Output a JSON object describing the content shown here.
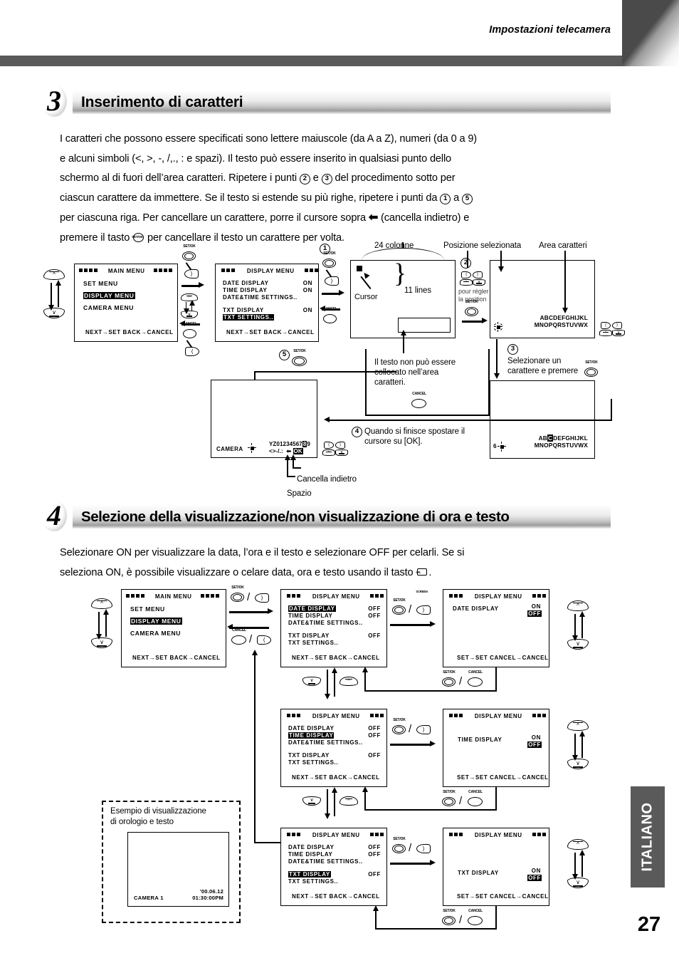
{
  "header": {
    "title": "Impostazioni telecamera"
  },
  "footer": {
    "language_tab": "ITALIANO",
    "page_number": "27"
  },
  "section3": {
    "number": "3",
    "title": "Inserimento di caratteri",
    "paragraph_lines": [
      "I caratteri che possono essere specificati sono lettere maiuscole (da A a Z), numeri (da 0 a 9)",
      "e alcuni simboli (<, >, -, /,., : e spazi). Il testo può essere inserito in qualsiasi punto dello",
      "schermo al di fuori dell’area caratteri. Ripetere i punti ② e ③ del procedimento sotto per",
      "ciascun carattere da immettere. Se il testo si estende su più righe, ripetere i punti da ① a ⑤",
      "per ciascuna riga. Per cancellare un carattere, porre il cursore sopra ← (cancella indietro) e",
      "premere il tasto ⊙ per cancellare il testo un carattere per volta."
    ]
  },
  "section4": {
    "number": "4",
    "title": "Selezione della visualizzazione/non visualizzazione di ora e testo",
    "paragraph_lines": [
      "Selezionare ON per visualizzare la data, l’ora e il testo e selezionare OFF per celarli. Se si",
      "seleziona ON, è possibile visualizzare o celare data, ora e testo usando il tasto ▭ ."
    ]
  },
  "buttons": {
    "setok": "SET/OK",
    "cancel": "CANCEL",
    "onscreen": "ON SCREEN"
  },
  "diagram1": {
    "screen_main_menu": {
      "title": "MAIN  MENU",
      "items": [
        "SET MENU",
        "DISPLAY MENU",
        "CAMERA MENU"
      ],
      "selected": "DISPLAY MENU",
      "footer": "NEXT→SET  BACK→CANCEL"
    },
    "screen_display_menu": {
      "title": "DISPLAY MENU",
      "rows": [
        {
          "label": "DATE DISPLAY",
          "value": "ON"
        },
        {
          "label": "TIME DISPLAY",
          "value": "ON"
        },
        {
          "label": "DATE&TIME SETTINGS..",
          "value": ""
        },
        {
          "label": "TXT DISPLAY",
          "value": "ON"
        },
        {
          "label": "TXT SETTINGS..",
          "value": ""
        }
      ],
      "selected": "TXT SETTINGS..",
      "footer": "NEXT→SET  BACK→CANCEL"
    },
    "labels": {
      "columns": "24 colonne",
      "selected_position": "Posizione selezionata",
      "char_area": "Area caratteri",
      "cursor": "Cursor",
      "lines": "11 lines",
      "no_text_note": "Il testo non può essere collocato nell’area caratteri.",
      "pour_regler": "pour régler la position",
      "step3_note": "Selezionare un carattere e premere",
      "step4_note": "Quando si finisce spostare il cursore su [OK].",
      "cancella_indietro": "Cancella indietro",
      "spazio": "Spazio"
    },
    "steps": {
      "s1": "1",
      "s2": "2",
      "s3": "3",
      "s4": "4",
      "s5": "5"
    },
    "char_palette": {
      "line1": "ABCDEFGHIJKL",
      "line2": "MNOPQRSTUVWX"
    },
    "char_palette_selected": {
      "line1": "ABCDEFGHIJKL",
      "line2": "MNOPQRSTUVWX",
      "highlight": "C"
    },
    "text_entry_screen": {
      "camera_label": "CAMERA",
      "entered_char": "",
      "palette_line1": "YZ0123456789",
      "palette_line2": "<>-/.:  ←",
      "ok_key": "OK",
      "second_char": "6"
    }
  },
  "diagram2": {
    "screen_main_menu": {
      "title": "MAIN  MENU",
      "items": [
        "SET MENU",
        "DISPLAY MENU",
        "CAMERA MENU"
      ],
      "selected": "DISPLAY MENU",
      "footer": "NEXT→SET  BACK→CANCEL"
    },
    "rows": [
      {
        "list_screen": {
          "title": "DISPLAY MENU",
          "rows": [
            {
              "label": "DATE DISPLAY",
              "value": "OFF"
            },
            {
              "label": "TIME DISPLAY",
              "value": "OFF"
            },
            {
              "label": "DATE&TIME SETTINGS..",
              "value": ""
            },
            {
              "label": "TXT DISPLAY",
              "value": "OFF"
            },
            {
              "label": "TXT SETTINGS..",
              "value": ""
            }
          ],
          "selected": "DATE DISPLAY",
          "footer": "NEXT→SET  BACK→CANCEL"
        },
        "detail_screen": {
          "title": "DISPLAY MENU",
          "item_label": "DATE DISPLAY",
          "option_on": "ON",
          "option_off": "OFF",
          "selected_option": "OFF",
          "footer": "SET→SET CANCEL→CANCEL"
        }
      },
      {
        "list_screen": {
          "title": "DISPLAY MENU",
          "rows": [
            {
              "label": "DATE DISPLAY",
              "value": "OFF"
            },
            {
              "label": "TIME DISPLAY",
              "value": "OFF"
            },
            {
              "label": "DATE&TIME SETTINGS..",
              "value": ""
            },
            {
              "label": "TXT DISPLAY",
              "value": "OFF"
            },
            {
              "label": "TXT SETTINGS..",
              "value": ""
            }
          ],
          "selected": "TIME DISPLAY",
          "footer": "NEXT→SET  BACK→CANCEL"
        },
        "detail_screen": {
          "title": "DISPLAY MENU",
          "item_label": "TIME DISPLAY",
          "option_on": "ON",
          "option_off": "OFF",
          "selected_option": "OFF",
          "footer": "SET→SET CANCEL→CANCEL"
        }
      },
      {
        "list_screen": {
          "title": "DISPLAY MENU",
          "rows": [
            {
              "label": "DATE DISPLAY",
              "value": "OFF"
            },
            {
              "label": "TIME DISPLAY",
              "value": "OFF"
            },
            {
              "label": "DATE&TIME SETTINGS..",
              "value": ""
            },
            {
              "label": "TXT DISPLAY",
              "value": "OFF"
            },
            {
              "label": "TXT SETTINGS..",
              "value": ""
            }
          ],
          "selected": "TXT DISPLAY",
          "footer": "NEXT→SET  BACK→CANCEL"
        },
        "detail_screen": {
          "title": "DISPLAY MENU",
          "item_label": "TXT DISPLAY",
          "option_on": "ON",
          "option_off": "OFF",
          "selected_option": "OFF",
          "footer": "SET→SET CANCEL→CANCEL"
        }
      }
    ],
    "example_box": {
      "caption_line1": "Esempio di visualizzazione",
      "caption_line2": "di orologio e testo",
      "camera_text": "CAMERA 1",
      "date": "'00.06.12",
      "time": "01:30:00PM"
    }
  }
}
